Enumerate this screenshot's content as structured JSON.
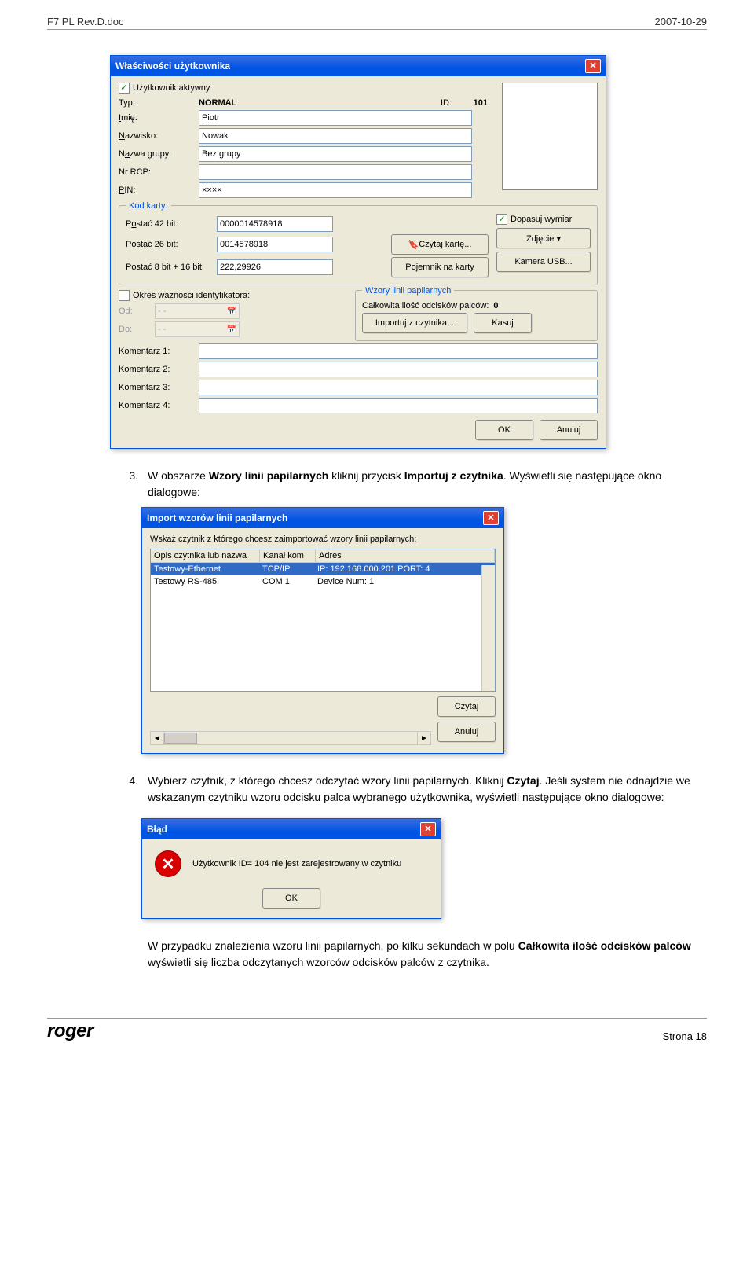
{
  "header": {
    "left": "F7 PL Rev.D.doc",
    "right": "2007-10-29"
  },
  "dlg1": {
    "title": "Właściwości użytkownika",
    "active_user": "Użytkownik aktywny",
    "type_lbl": "Typ:",
    "type_val": "NORMAL",
    "id_lbl": "ID:",
    "id_val": "101",
    "fname_lbl": "Imię:",
    "fname_val": "Piotr",
    "lname_lbl": "Nazwisko:",
    "lname_val": "Nowak",
    "group_lbl": "Nazwa grupy:",
    "group_val": "Bez grupy",
    "rcp_lbl": "Nr RCP:",
    "pin_lbl": "PIN:",
    "pin_val": "××××",
    "card_title": "Kod karty:",
    "c42_lbl": "Postać 42 bit:",
    "c42_val": "0000014578918",
    "c26_lbl": "Postać 26 bit:",
    "c26_val": "0014578918",
    "c816_lbl": "Postać 8 bit + 16 bit:",
    "c816_val": "222,29926",
    "btn_read_card": "Czytaj kartę...",
    "btn_card_holder": "Pojemnik na karty",
    "fit_dim": "Dopasuj wymiar",
    "btn_photo": "Zdjęcie ▾",
    "btn_usb_cam": "Kamera USB...",
    "valid_title": "Okres ważności identyfikatora:",
    "from_lbl": "Od:",
    "to_lbl": "Do:",
    "date_placeholder": " - -",
    "fp_title": "Wzory linii papilarnych",
    "fp_total": "Całkowita ilość odcisków palców:",
    "fp_count": "0",
    "btn_import": "Importuj z czytnika...",
    "btn_clear": "Kasuj",
    "c1": "Komentarz 1:",
    "c2": "Komentarz 2:",
    "c3": "Komentarz 3:",
    "c4": "Komentarz 4:",
    "ok": "OK",
    "cancel": "Anuluj"
  },
  "steps": {
    "s3a": "W obszarze ",
    "s3b": "Wzory linii papilarnych",
    "s3c": " kliknij przycisk ",
    "s3d": "Importuj z czytnika",
    "s3e": ". Wyświetli się następujące okno dialogowe:"
  },
  "dlg2": {
    "title": "Import wzorów linii papilarnych",
    "hint": "Wskaż czytnik z którego chcesz zaimportować wzory linii papilarnych:",
    "col1": "Opis czytnika lub nazwa",
    "col2": "Kanał kom",
    "col3": "Adres",
    "r1c1": "Testowy-Ethernet",
    "r1c2": "TCP/IP",
    "r1c3": "IP: 192.168.000.201 PORT: 4",
    "r2c1": "Testowy RS-485",
    "r2c2": "COM 1",
    "r2c3": "Device Num: 1",
    "btn_read": "Czytaj",
    "btn_cancel": "Anuluj"
  },
  "steps2": {
    "s4a": "Wybierz czytnik, z którego chcesz odczytać wzory linii papilarnych. Kliknij ",
    "s4b": "Czytaj",
    "s4c": ". Jeśli system nie odnajdzie we wskazanym czytniku wzoru odcisku palca wybranego użytkownika, wyświetli następujące okno dialogowe:"
  },
  "dlg3": {
    "title": "Błąd",
    "msg": "Użytkownik ID= 104 nie jest zarejestrowany w czytniku",
    "ok": "OK"
  },
  "tail": {
    "t1": "W przypadku znalezienia wzoru linii papilarnych, po kilku sekundach w polu ",
    "t2": "Całkowita ilość odcisków palców",
    "t3": " wyświetli się liczba odczytanych wzorców odcisków palców z czytnika."
  },
  "footer": {
    "brand": "roger",
    "page": "Strona 18"
  }
}
